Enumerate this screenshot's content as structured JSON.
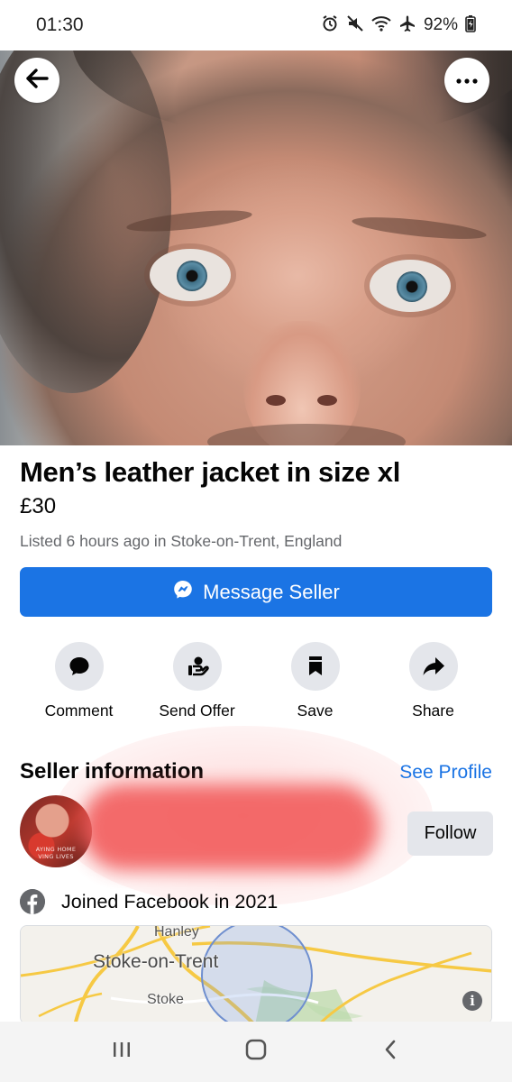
{
  "status_bar": {
    "time": "01:30",
    "battery": "92%",
    "icons": [
      "alarm-icon",
      "mute-icon",
      "wifi-icon",
      "airplane-icon",
      "battery-icon"
    ]
  },
  "listing": {
    "title": "Men’s leather jacket in size xl",
    "price": "£30",
    "listed": "Listed 6 hours ago in Stoke-on-Trent, England"
  },
  "message_button": {
    "label": "Message Seller",
    "icon": "messenger-icon"
  },
  "actions": [
    {
      "label": "Comment",
      "icon": "comment-icon"
    },
    {
      "label": "Send Offer",
      "icon": "send-offer-icon"
    },
    {
      "label": "Save",
      "icon": "bookmark-icon"
    },
    {
      "label": "Share",
      "icon": "share-icon"
    }
  ],
  "seller": {
    "heading": "Seller information",
    "see_profile": "See Profile",
    "avatar_text": "AYING HOME\nVING LIVES",
    "follow_label": "Follow",
    "joined": "Joined Facebook in 2021"
  },
  "map": {
    "labels": {
      "hanley": "Hanley",
      "city": "Stoke-on-Trent",
      "stoke": "Stoke"
    },
    "info_symbol": "i"
  },
  "colors": {
    "accent": "#1b74e4",
    "button_grey": "#e4e6eb",
    "secondary_text": "#65676b"
  }
}
